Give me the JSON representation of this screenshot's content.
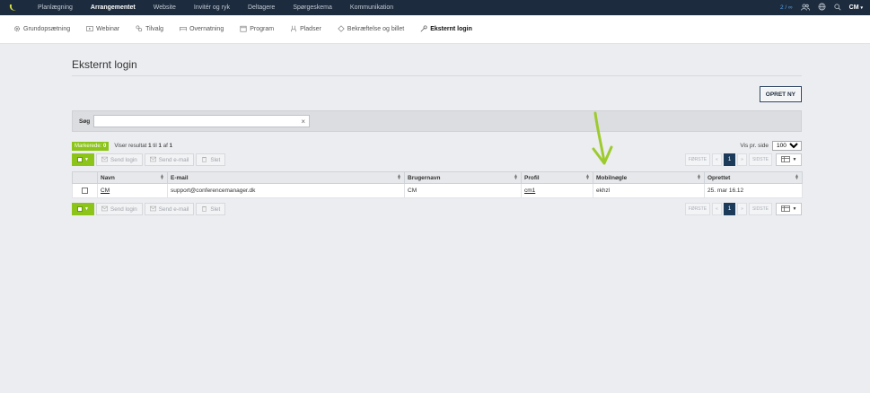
{
  "topnav": {
    "items": [
      "Planlægning",
      "Arrangementet",
      "Website",
      "Invitér og ryk",
      "Deltagere",
      "Spørgeskema",
      "Kommunikation"
    ],
    "active_index": 1,
    "counter": "2 / ∞",
    "user_initials": "CM"
  },
  "subnav": {
    "items": [
      {
        "label": "Grundopsætning",
        "icon": "gear-icon"
      },
      {
        "label": "Webinar",
        "icon": "video-icon"
      },
      {
        "label": "Tilvalg",
        "icon": "options-icon"
      },
      {
        "label": "Overnatning",
        "icon": "bed-icon"
      },
      {
        "label": "Program",
        "icon": "calendar-icon"
      },
      {
        "label": "Pladser",
        "icon": "seat-icon"
      },
      {
        "label": "Bekræftelse og billet",
        "icon": "ticket-icon"
      },
      {
        "label": "Eksternt login",
        "icon": "key-icon"
      }
    ],
    "active_index": 7
  },
  "page": {
    "title": "Eksternt login",
    "create_button": "OPRET NY"
  },
  "search": {
    "label": "Søg",
    "value": "",
    "placeholder": ""
  },
  "info": {
    "marked_label": "Markerede:",
    "marked_count": "0",
    "result_prefix": "Viser resultat",
    "result_from": "1",
    "result_to_word": "til",
    "result_to": "1",
    "result_of_word": "af",
    "result_total": "1",
    "per_page_label": "Vis pr. side",
    "per_page_value": "100"
  },
  "toolbar": {
    "send_login": "Send login",
    "send_email": "Send e-mail",
    "delete": "Slet"
  },
  "pager": {
    "first": "FØRSTE",
    "prev": "«",
    "current": "1",
    "next": "»",
    "last": "SIDSTE"
  },
  "table": {
    "columns": [
      "Navn",
      "E-mail",
      "Brugernavn",
      "Profil",
      "Mobilnøgle",
      "Oprettet"
    ],
    "rows": [
      {
        "navn": "CM",
        "email": "support@conferencemanager.dk",
        "brugernavn": "CM",
        "profil": "cm1",
        "mobilnoegle": "ekhzl",
        "oprettet": "25. mar 16.12"
      }
    ]
  },
  "colors": {
    "topbar": "#1c2b3d",
    "accent_green": "#8cc41a",
    "pager_active": "#1c3b5a"
  }
}
